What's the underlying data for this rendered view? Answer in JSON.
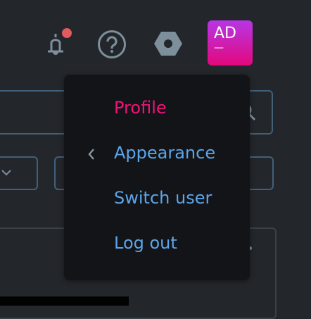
{
  "header": {
    "avatar_initials": "AD",
    "avatar_sub": "—",
    "notification_dot_color": "#e05a5e"
  },
  "menu": {
    "items": [
      {
        "label": "Profile",
        "color": "#f0137a"
      },
      {
        "label": "Appearance",
        "icon": "chevron-left-icon"
      },
      {
        "label": "Switch user"
      },
      {
        "label": "Log out"
      }
    ]
  }
}
